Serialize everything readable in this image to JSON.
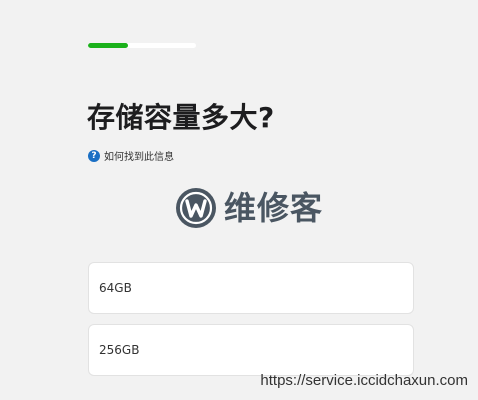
{
  "progress": {
    "fraction": 0.37,
    "fill_color": "#1bb11b",
    "track_color": "#ffffff"
  },
  "question": {
    "title": "存储容量多大?",
    "help_icon": "question-circle-icon",
    "help_text": "如何找到此信息"
  },
  "logo": {
    "text": "维修客",
    "icon": "w-logo-icon",
    "color": "#4a5662"
  },
  "options": [
    {
      "label": "64GB"
    },
    {
      "label": "256GB"
    }
  ],
  "watermark": {
    "url": "https://service.iccidchaxun.com"
  }
}
